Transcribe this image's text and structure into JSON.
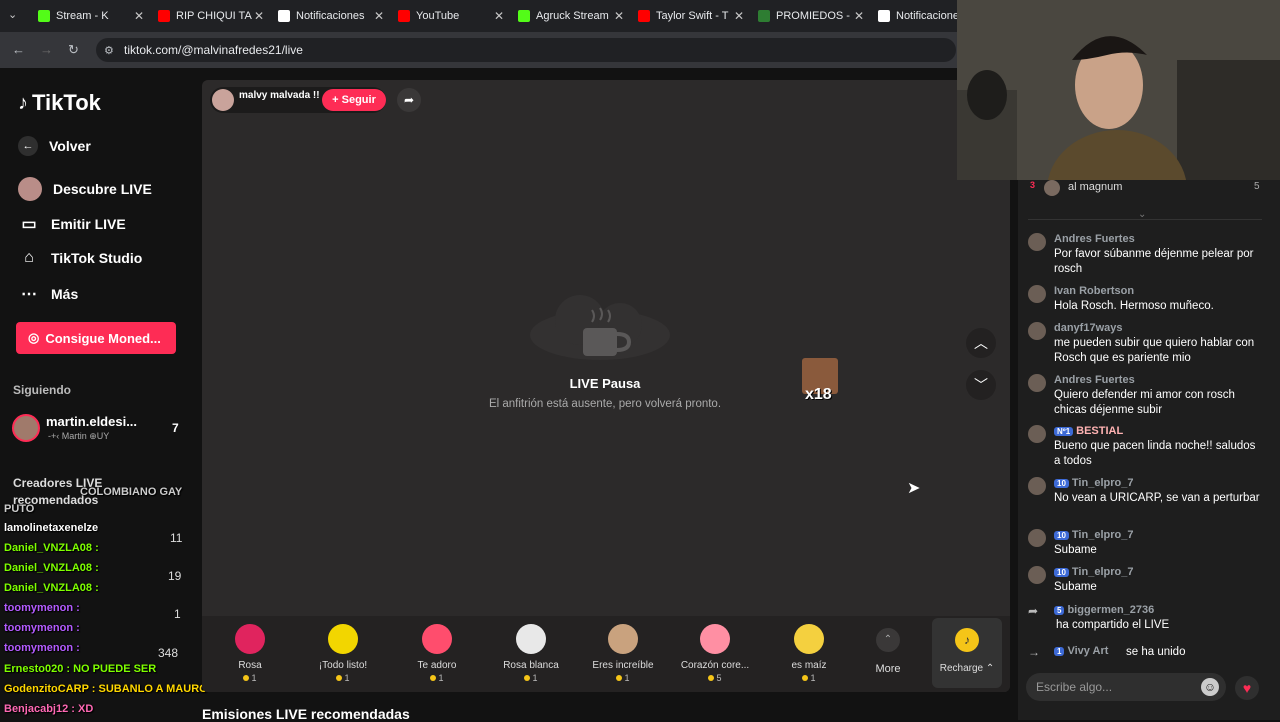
{
  "tabs": [
    {
      "title": "Stream - K",
      "color": "#53fc18"
    },
    {
      "title": "RIP CHIQUI TA",
      "color": "#ff0000"
    },
    {
      "title": "Notificaciones",
      "color": "#ffffff"
    },
    {
      "title": "YouTube",
      "color": "#ff0000"
    },
    {
      "title": "Agruck Stream",
      "color": "#53fc18"
    },
    {
      "title": "Taylor Swift - T",
      "color": "#ff0000"
    },
    {
      "title": "PROMIEDOS -",
      "color": "#2e7d32"
    },
    {
      "title": "Notificaciones",
      "color": "#ffffff"
    }
  ],
  "url": "tiktok.com/@malvinafredes21/live",
  "sidebar": {
    "logo": "TikTok",
    "back": "Volver",
    "items": [
      "Descubre LIVE",
      "Emitir LIVE",
      "TikTok Studio",
      "Más"
    ],
    "coins_button": "Consigue Moned...",
    "following_label": "Siguiendo",
    "following": {
      "name": "martin.eldesi...",
      "sub": "-+‹ Martin ⊕UY",
      "count": "7"
    },
    "creators_label": "Creadores LIVE recomendados",
    "counts": [
      "11",
      "19",
      "1",
      "348"
    ]
  },
  "overlay_chat": [
    {
      "text": "COLOMBIANO GAY",
      "color": "#cccccc"
    },
    {
      "text": "PUTO",
      "color": "#cccccc"
    },
    {
      "text": "lamolinetaxenelze",
      "color": "#ffffff"
    },
    {
      "text": "Daniel_VNZLA08 :",
      "color": "#7fff00"
    },
    {
      "text": "Daniel_VNZLA08 :",
      "color": "#7fff00"
    },
    {
      "text": "Daniel_VNZLA08 :",
      "color": "#7fff00"
    },
    {
      "text": "toomymenon :",
      "color": "#b45cff"
    },
    {
      "text": "toomymenon :",
      "color": "#b45cff"
    },
    {
      "text": "toomymenon :",
      "color": "#b45cff"
    },
    {
      "text": "Ernesto020 : NO PUEDE SER",
      "color": "#7fff00"
    },
    {
      "text": "GodenzitoCARP : SUBANLO A MAURO",
      "color": "#ffd700"
    },
    {
      "text": "Benjacabj12 : XD",
      "color": "#ff69b4"
    }
  ],
  "host": {
    "name": "malvy malvada !!",
    "follow": "+ Seguir"
  },
  "pause": {
    "title": "LIVE Pausa",
    "subtitle": "El anfitrión está ausente, pero volverá pronto."
  },
  "sticker": "x18",
  "gifts": [
    {
      "name": "Rosa",
      "price": "1",
      "color": "#e0245e"
    },
    {
      "name": "¡Todo listo!",
      "price": "1",
      "color": "#f2d600"
    },
    {
      "name": "Te adoro",
      "price": "1",
      "color": "#ff4d6d"
    },
    {
      "name": "Rosa blanca",
      "price": "1",
      "color": "#e8e8e8"
    },
    {
      "name": "Eres increíble",
      "price": "1",
      "color": "#c9a27e"
    },
    {
      "name": "Corazón core...",
      "price": "5",
      "color": "#ff8fa3"
    },
    {
      "name": "es maíz",
      "price": "1",
      "color": "#f4d03f"
    }
  ],
  "more": "More",
  "recharge": "Recharge ⌃",
  "recommended": "Emisiones LIVE recomendadas",
  "ranking": {
    "rank": "3",
    "name": "al magnum",
    "value": "5"
  },
  "chat": [
    {
      "user": "Andres Fuertes",
      "text": "Por favor súbanme déjenme pelear por rosch",
      "lvl": ""
    },
    {
      "user": "Ivan Robertson",
      "text": "Hola Rosch. Hermoso muñeco.",
      "lvl": ""
    },
    {
      "user": "danyf17ways",
      "text": "me pueden subir que quiero hablar con Rosch que es pariente mio",
      "lvl": ""
    },
    {
      "user": "Andres Fuertes",
      "text": "Quiero defender mi amor con rosch chicas déjenme subir",
      "lvl": ""
    },
    {
      "user": "BESTIAL",
      "text": "Bueno que pacen linda noche!! saludos a todos",
      "lvl": "Nº1"
    },
    {
      "user": "Tin_elpro_7",
      "text": "No vean a URICARP, se van a perturbar",
      "lvl": "10"
    },
    {
      "user": "Tin_elpro_7",
      "text": "Subame",
      "lvl": "10"
    },
    {
      "user": "Tin_elpro_7",
      "text": "Subame",
      "lvl": "10"
    },
    {
      "user": "biggermen_2736",
      "text": "ha compartido el LIVE",
      "lvl": "5"
    },
    {
      "user": "Vivy Art",
      "text": "se ha unido",
      "lvl": "1"
    }
  ],
  "chat_input_placeholder": "Escribe algo..."
}
